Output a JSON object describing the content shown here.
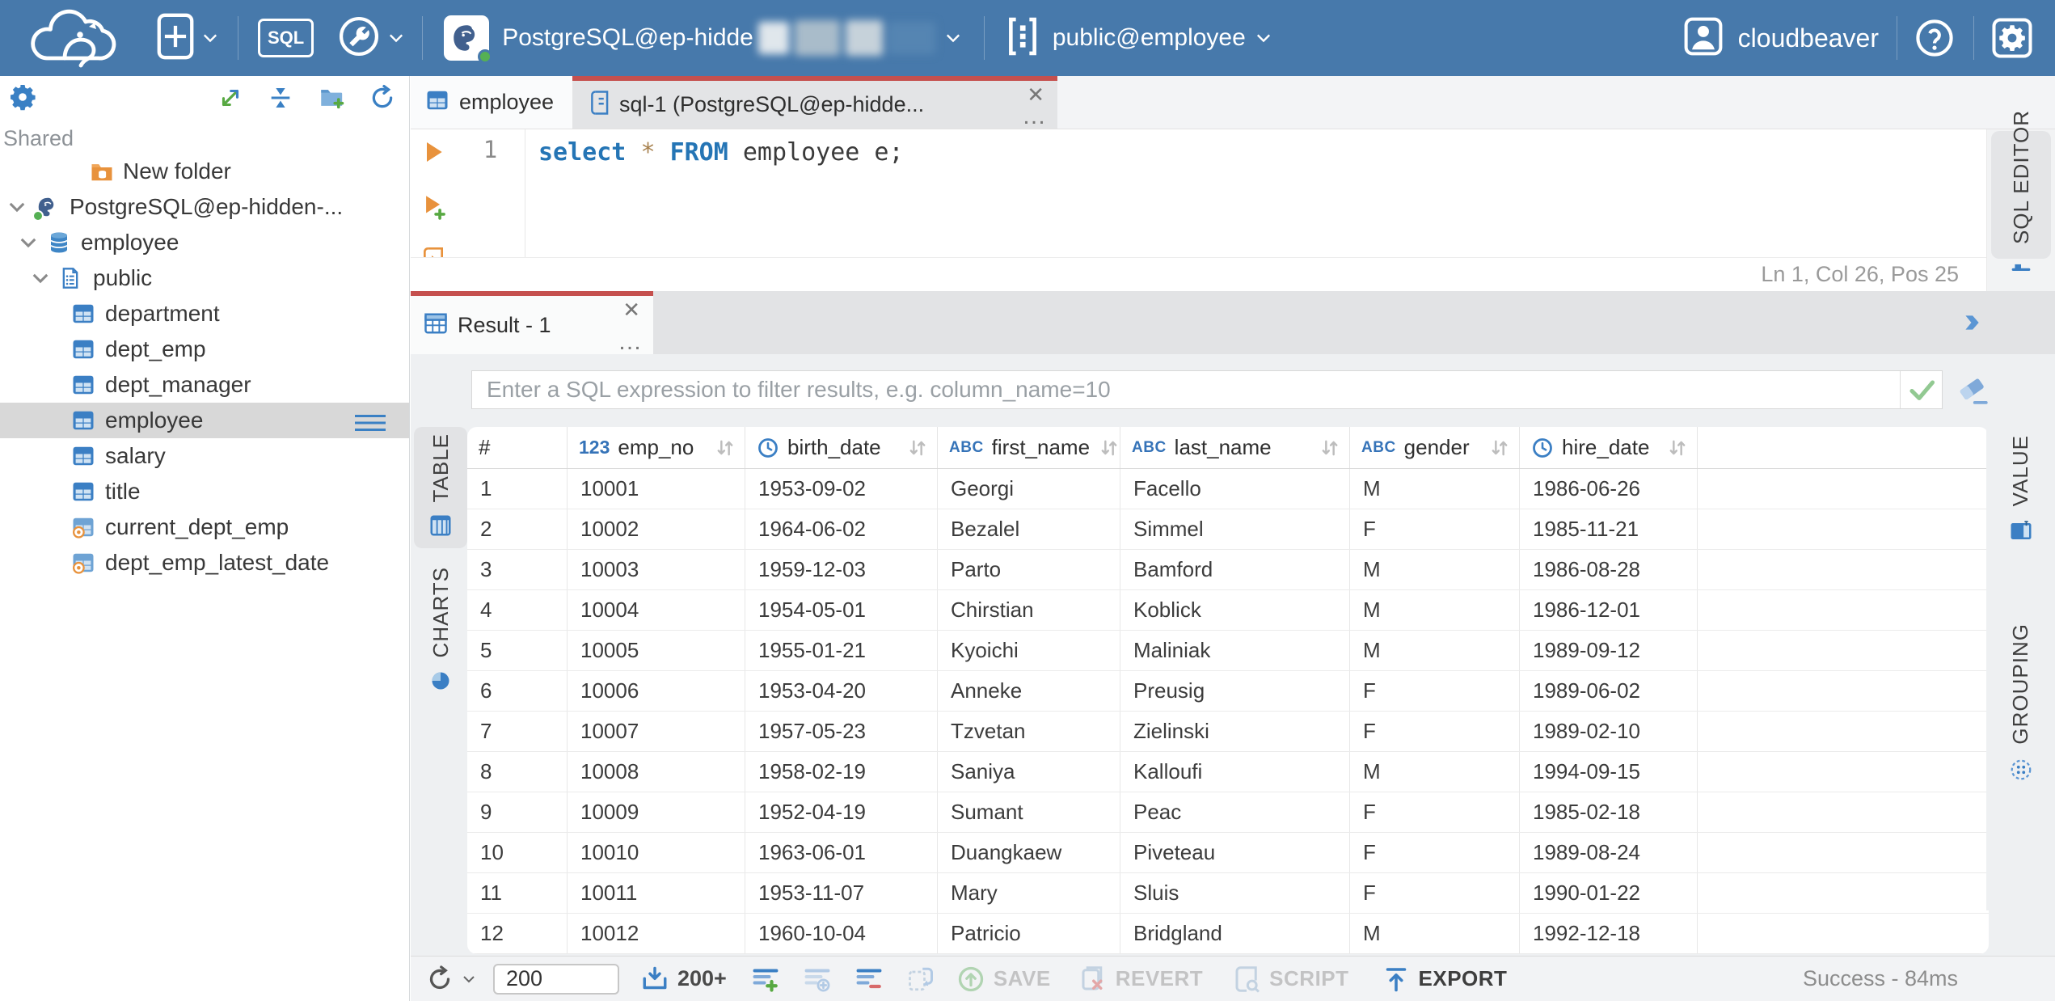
{
  "topbar": {
    "connection": {
      "label": "PostgreSQL@ep-hidde",
      "redacted": true
    },
    "schema": {
      "label": "public@employee"
    },
    "sql_button": "SQL",
    "user": {
      "name": "cloudbeaver"
    }
  },
  "sidebar": {
    "section_label": "Shared",
    "tree": [
      {
        "label": "New folder",
        "icon": "folder-db",
        "depth": 4,
        "chevron": false,
        "selected": false
      },
      {
        "label": "PostgreSQL@ep-hidden-...",
        "icon": "postgres",
        "depth": 0,
        "chevron": true,
        "selected": false
      },
      {
        "label": "employee",
        "icon": "database",
        "depth": 1,
        "chevron": true,
        "selected": false
      },
      {
        "label": "public",
        "icon": "schema",
        "depth": 2,
        "chevron": true,
        "selected": false
      },
      {
        "label": "department",
        "icon": "table",
        "depth": 3,
        "chevron": false,
        "selected": false
      },
      {
        "label": "dept_emp",
        "icon": "table",
        "depth": 3,
        "chevron": false,
        "selected": false
      },
      {
        "label": "dept_manager",
        "icon": "table",
        "depth": 3,
        "chevron": false,
        "selected": false
      },
      {
        "label": "employee",
        "icon": "table",
        "depth": 3,
        "chevron": false,
        "selected": true
      },
      {
        "label": "salary",
        "icon": "table",
        "depth": 3,
        "chevron": false,
        "selected": false
      },
      {
        "label": "title",
        "icon": "table",
        "depth": 3,
        "chevron": false,
        "selected": false
      },
      {
        "label": "current_dept_emp",
        "icon": "view",
        "depth": 3,
        "chevron": false,
        "selected": false
      },
      {
        "label": "dept_emp_latest_date",
        "icon": "view",
        "depth": 3,
        "chevron": false,
        "selected": false
      }
    ]
  },
  "editor_tabs": [
    {
      "label": "employee",
      "icon": "table",
      "active": false
    },
    {
      "label": "sql-1 (PostgreSQL@ep-hidde...",
      "icon": "sql-script",
      "active": true,
      "close": "✕",
      "more": "…"
    }
  ],
  "editor": {
    "line_number": "1",
    "sql_tokens": [
      {
        "text": "select",
        "style": "kw"
      },
      {
        "text": " ",
        "style": "pl"
      },
      {
        "text": "*",
        "style": "op"
      },
      {
        "text": " ",
        "style": "pl"
      },
      {
        "text": "FROM",
        "style": "kw"
      },
      {
        "text": " employee e;",
        "style": "pl"
      }
    ],
    "status": "Ln 1, Col 26, Pos 25",
    "side_tab": "SQL EDITOR"
  },
  "result": {
    "tab": {
      "label": "Result - 1",
      "close": "✕",
      "more": "…"
    },
    "filter_placeholder": "Enter a SQL expression to filter results, e.g. column_name=10",
    "left_tabs": [
      {
        "label": "TABLE",
        "active": true
      },
      {
        "label": "CHARTS",
        "active": false
      }
    ],
    "right_tabs": [
      {
        "label": "VALUE"
      },
      {
        "label": "GROUPING"
      }
    ],
    "grid": {
      "index_header": "#",
      "badges": {
        "number": "123",
        "string": "ABC"
      },
      "columns": [
        {
          "label": "emp_no",
          "type": "number"
        },
        {
          "label": "birth_date",
          "type": "date"
        },
        {
          "label": "first_name",
          "type": "string"
        },
        {
          "label": "last_name",
          "type": "string"
        },
        {
          "label": "gender",
          "type": "string"
        },
        {
          "label": "hire_date",
          "type": "date"
        }
      ],
      "rows": [
        [
          "1",
          "10001",
          "1953-09-02",
          "Georgi",
          "Facello",
          "M",
          "1986-06-26"
        ],
        [
          "2",
          "10002",
          "1964-06-02",
          "Bezalel",
          "Simmel",
          "F",
          "1985-11-21"
        ],
        [
          "3",
          "10003",
          "1959-12-03",
          "Parto",
          "Bamford",
          "M",
          "1986-08-28"
        ],
        [
          "4",
          "10004",
          "1954-05-01",
          "Chirstian",
          "Koblick",
          "M",
          "1986-12-01"
        ],
        [
          "5",
          "10005",
          "1955-01-21",
          "Kyoichi",
          "Maliniak",
          "M",
          "1989-09-12"
        ],
        [
          "6",
          "10006",
          "1953-04-20",
          "Anneke",
          "Preusig",
          "F",
          "1989-06-02"
        ],
        [
          "7",
          "10007",
          "1957-05-23",
          "Tzvetan",
          "Zielinski",
          "F",
          "1989-02-10"
        ],
        [
          "8",
          "10008",
          "1958-02-19",
          "Saniya",
          "Kalloufi",
          "M",
          "1994-09-15"
        ],
        [
          "9",
          "10009",
          "1952-04-19",
          "Sumant",
          "Peac",
          "F",
          "1985-02-18"
        ],
        [
          "10",
          "10010",
          "1963-06-01",
          "Duangkaew",
          "Piveteau",
          "F",
          "1989-08-24"
        ],
        [
          "11",
          "10011",
          "1953-11-07",
          "Mary",
          "Sluis",
          "F",
          "1990-01-22"
        ],
        [
          "12",
          "10012",
          "1960-10-04",
          "Patricio",
          "Bridgland",
          "M",
          "1992-12-18"
        ]
      ]
    },
    "toolbar": {
      "row_limit": "200",
      "fetch_size_label": "200+",
      "save_label": "SAVE",
      "revert_label": "REVERT",
      "script_label": "SCRIPT",
      "export_label": "EXPORT",
      "status": "Success - 84ms"
    }
  },
  "colors": {
    "topbar_blue": "#4779ab",
    "accent_red": "#c5504e",
    "icon_blue": "#3b7fc4",
    "success_green": "#58a942"
  }
}
